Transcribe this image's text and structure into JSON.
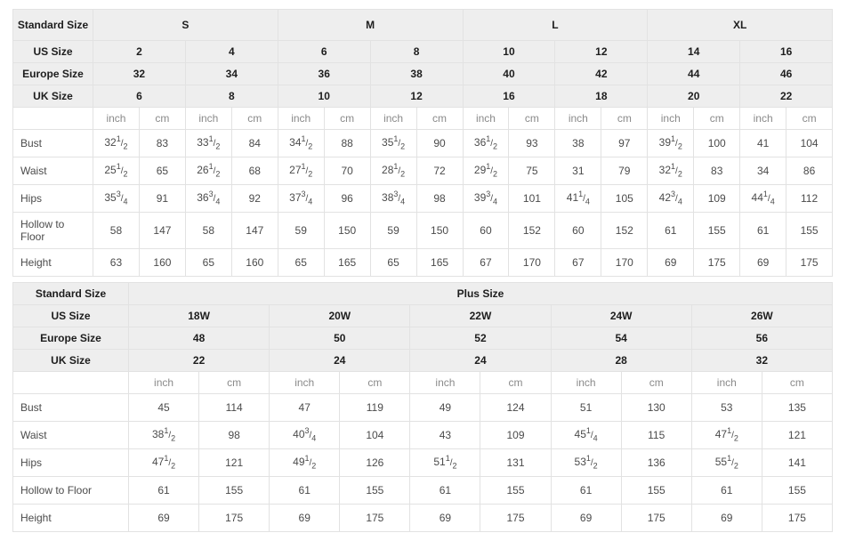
{
  "standard_table": {
    "label_header": "Standard Size",
    "group_row": {
      "label": "Standard Size",
      "groups": [
        "S",
        "M",
        "L",
        "XL"
      ]
    },
    "size_rows": [
      {
        "label": "US Size",
        "values": [
          "2",
          "4",
          "6",
          "8",
          "10",
          "12",
          "14",
          "16"
        ]
      },
      {
        "label": "Europe Size",
        "values": [
          "32",
          "34",
          "36",
          "38",
          "40",
          "42",
          "44",
          "46"
        ]
      },
      {
        "label": "UK Size",
        "values": [
          "6",
          "8",
          "10",
          "12",
          "16",
          "18",
          "20",
          "22"
        ]
      }
    ],
    "unit_row": {
      "label": "",
      "units": [
        "inch",
        "cm",
        "inch",
        "cm",
        "inch",
        "cm",
        "inch",
        "cm",
        "inch",
        "cm",
        "inch",
        "cm",
        "inch",
        "cm",
        "inch",
        "cm"
      ]
    },
    "measure_rows": [
      {
        "label": "Bust",
        "cells": [
          {
            "w": "32",
            "n": "1",
            "d": "2"
          },
          {
            "w": "83"
          },
          {
            "w": "33",
            "n": "1",
            "d": "2"
          },
          {
            "w": "84"
          },
          {
            "w": "34",
            "n": "1",
            "d": "2"
          },
          {
            "w": "88"
          },
          {
            "w": "35",
            "n": "1",
            "d": "2"
          },
          {
            "w": "90"
          },
          {
            "w": "36",
            "n": "1",
            "d": "2"
          },
          {
            "w": "93"
          },
          {
            "w": "38"
          },
          {
            "w": "97"
          },
          {
            "w": "39",
            "n": "1",
            "d": "2"
          },
          {
            "w": "100"
          },
          {
            "w": "41"
          },
          {
            "w": "104"
          }
        ]
      },
      {
        "label": "Waist",
        "cells": [
          {
            "w": "25",
            "n": "1",
            "d": "2"
          },
          {
            "w": "65"
          },
          {
            "w": "26",
            "n": "1",
            "d": "2"
          },
          {
            "w": "68"
          },
          {
            "w": "27",
            "n": "1",
            "d": "2"
          },
          {
            "w": "70"
          },
          {
            "w": "28",
            "n": "1",
            "d": "2"
          },
          {
            "w": "72"
          },
          {
            "w": "29",
            "n": "1",
            "d": "2"
          },
          {
            "w": "75"
          },
          {
            "w": "31"
          },
          {
            "w": "79"
          },
          {
            "w": "32",
            "n": "1",
            "d": "2"
          },
          {
            "w": "83"
          },
          {
            "w": "34"
          },
          {
            "w": "86"
          }
        ]
      },
      {
        "label": "Hips",
        "cells": [
          {
            "w": "35",
            "n": "3",
            "d": "4"
          },
          {
            "w": "91"
          },
          {
            "w": "36",
            "n": "3",
            "d": "4"
          },
          {
            "w": "92"
          },
          {
            "w": "37",
            "n": "3",
            "d": "4"
          },
          {
            "w": "96"
          },
          {
            "w": "38",
            "n": "3",
            "d": "4"
          },
          {
            "w": "98"
          },
          {
            "w": "39",
            "n": "3",
            "d": "4"
          },
          {
            "w": "101"
          },
          {
            "w": "41",
            "n": "1",
            "d": "4"
          },
          {
            "w": "105"
          },
          {
            "w": "42",
            "n": "3",
            "d": "4"
          },
          {
            "w": "109"
          },
          {
            "w": "44",
            "n": "1",
            "d": "4"
          },
          {
            "w": "112"
          }
        ]
      },
      {
        "label": "Hollow to Floor",
        "tall": true,
        "cells": [
          {
            "w": "58"
          },
          {
            "w": "147"
          },
          {
            "w": "58"
          },
          {
            "w": "147"
          },
          {
            "w": "59"
          },
          {
            "w": "150"
          },
          {
            "w": "59"
          },
          {
            "w": "150"
          },
          {
            "w": "60"
          },
          {
            "w": "152"
          },
          {
            "w": "60"
          },
          {
            "w": "152"
          },
          {
            "w": "61"
          },
          {
            "w": "155"
          },
          {
            "w": "61"
          },
          {
            "w": "155"
          }
        ]
      },
      {
        "label": "Height",
        "cells": [
          {
            "w": "63"
          },
          {
            "w": "160"
          },
          {
            "w": "65"
          },
          {
            "w": "160"
          },
          {
            "w": "65"
          },
          {
            "w": "165"
          },
          {
            "w": "65"
          },
          {
            "w": "165"
          },
          {
            "w": "67"
          },
          {
            "w": "170"
          },
          {
            "w": "67"
          },
          {
            "w": "170"
          },
          {
            "w": "69"
          },
          {
            "w": "175"
          },
          {
            "w": "69"
          },
          {
            "w": "175"
          }
        ]
      }
    ]
  },
  "plus_table": {
    "group_row": {
      "label": "Standard Size",
      "title": "Plus Size"
    },
    "size_rows": [
      {
        "label": "US Size",
        "values": [
          "18W",
          "20W",
          "22W",
          "24W",
          "26W"
        ]
      },
      {
        "label": "Europe Size",
        "values": [
          "48",
          "50",
          "52",
          "54",
          "56"
        ]
      },
      {
        "label": "UK Size",
        "values": [
          "22",
          "24",
          "24",
          "28",
          "32"
        ]
      }
    ],
    "unit_row": {
      "label": "",
      "units": [
        "inch",
        "cm",
        "inch",
        "cm",
        "inch",
        "cm",
        "inch",
        "cm",
        "inch",
        "cm"
      ]
    },
    "measure_rows": [
      {
        "label": "Bust",
        "cells": [
          {
            "w": "45"
          },
          {
            "w": "114"
          },
          {
            "w": "47"
          },
          {
            "w": "119"
          },
          {
            "w": "49"
          },
          {
            "w": "124"
          },
          {
            "w": "51"
          },
          {
            "w": "130"
          },
          {
            "w": "53"
          },
          {
            "w": "135"
          }
        ]
      },
      {
        "label": "Waist",
        "cells": [
          {
            "w": "38",
            "n": "1",
            "d": "2"
          },
          {
            "w": "98"
          },
          {
            "w": "40",
            "n": "3",
            "d": "4"
          },
          {
            "w": "104"
          },
          {
            "w": "43"
          },
          {
            "w": "109"
          },
          {
            "w": "45",
            "n": "1",
            "d": "4"
          },
          {
            "w": "115"
          },
          {
            "w": "47",
            "n": "1",
            "d": "2"
          },
          {
            "w": "121"
          }
        ]
      },
      {
        "label": "Hips",
        "cells": [
          {
            "w": "47",
            "n": "1",
            "d": "2"
          },
          {
            "w": "121"
          },
          {
            "w": "49",
            "n": "1",
            "d": "2"
          },
          {
            "w": "126"
          },
          {
            "w": "51",
            "n": "1",
            "d": "2"
          },
          {
            "w": "131"
          },
          {
            "w": "53",
            "n": "1",
            "d": "2"
          },
          {
            "w": "136"
          },
          {
            "w": "55",
            "n": "1",
            "d": "2"
          },
          {
            "w": "141"
          }
        ]
      },
      {
        "label": "Hollow to Floor",
        "cells": [
          {
            "w": "61"
          },
          {
            "w": "155"
          },
          {
            "w": "61"
          },
          {
            "w": "155"
          },
          {
            "w": "61"
          },
          {
            "w": "155"
          },
          {
            "w": "61"
          },
          {
            "w": "155"
          },
          {
            "w": "61"
          },
          {
            "w": "155"
          }
        ]
      },
      {
        "label": "Height",
        "cells": [
          {
            "w": "69"
          },
          {
            "w": "175"
          },
          {
            "w": "69"
          },
          {
            "w": "175"
          },
          {
            "w": "69"
          },
          {
            "w": "175"
          },
          {
            "w": "69"
          },
          {
            "w": "175"
          },
          {
            "w": "69"
          },
          {
            "w": "175"
          }
        ]
      }
    ]
  },
  "colors": {
    "header_bg": "#eeeeee",
    "body_bg": "#ffffff",
    "border": "#e2e2e2",
    "header_text": "#1d1d1d",
    "body_text": "#4b4b4b",
    "unit_text": "#8a8a8a"
  }
}
